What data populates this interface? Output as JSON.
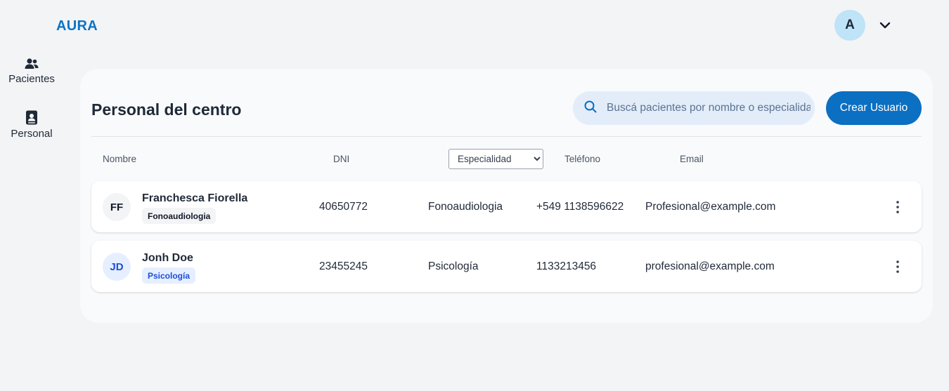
{
  "app": {
    "logo": "AURA"
  },
  "user": {
    "avatar_initial": "A"
  },
  "sidebar": {
    "items": [
      {
        "label": "Pacientes",
        "icon": "users-icon"
      },
      {
        "label": "Personal",
        "icon": "contact-book-icon"
      }
    ]
  },
  "page": {
    "title": "Personal del centro",
    "search_placeholder": "Buscá pacientes por nombre o especialidad",
    "create_button": "Crear Usuario"
  },
  "table": {
    "headers": {
      "nombre": "Nombre",
      "dni": "DNI",
      "especialidad": "Especialidad",
      "telefono": "Teléfono",
      "email": "Email"
    },
    "rows": [
      {
        "initials": "FF",
        "name": "Franchesca Fiorella",
        "tag": "Fonoaudiologia",
        "dni": "40650772",
        "especialidad": "Fonoaudiologia",
        "telefono": "+549 1138596622",
        "email": "Profesional@example.com"
      },
      {
        "initials": "JD",
        "name": "Jonh Doe",
        "tag": "Psicología",
        "dni": "23455245",
        "especialidad": "Psicología",
        "telefono": "1133213456",
        "email": "profesional@example.com"
      }
    ]
  },
  "colors": {
    "accent": "#0b6fc2",
    "logo": "#0b74c4",
    "background": "#f3f4f6",
    "panel": "#f8fafc"
  }
}
